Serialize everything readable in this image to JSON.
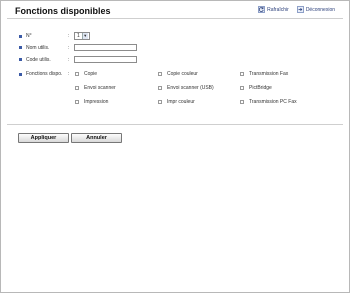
{
  "header": {
    "title": "Fonctions disponibles",
    "refresh_label": "Rafraîchir",
    "logout_label": "Déconnexion"
  },
  "form": {
    "number_label": "N°",
    "number_value": "1",
    "username_label": "Nom utilis.",
    "usercode_label": "Code utilis.",
    "functions_label": "Fonctions dispo."
  },
  "functions": [
    "Copie",
    "Copie couleur",
    "Transmission Fax",
    "Envoi scanner",
    "Envoi scanner (USB)",
    "PictBridge",
    "Impression",
    "Impr couleur",
    "Transmission PC Fax"
  ],
  "actions": {
    "apply_label": "Appliquer",
    "cancel_label": "Annuler"
  },
  "colors": {
    "accent": "#3b5aa6",
    "link": "#2b3f7a"
  }
}
